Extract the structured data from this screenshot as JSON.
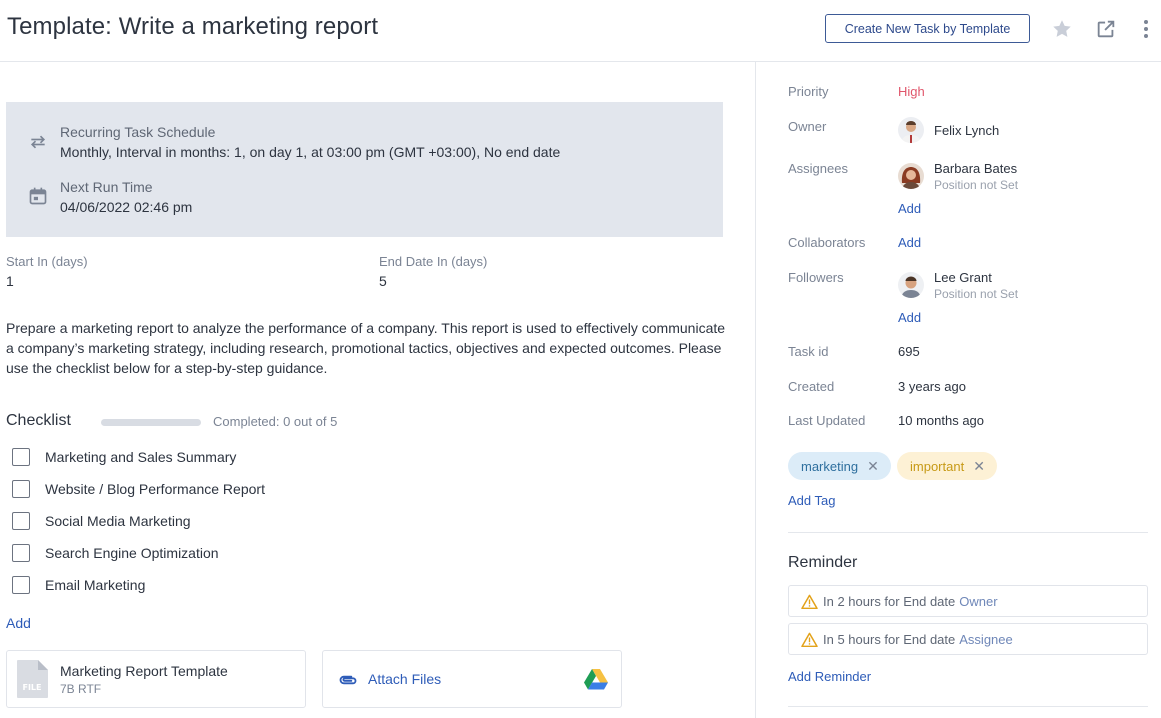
{
  "header": {
    "title": "Template: Write a marketing report",
    "create_button": "Create New Task by Template",
    "icons": [
      "star-icon",
      "external-link-icon",
      "more-vertical-icon"
    ]
  },
  "recurring": {
    "schedule_label": "Recurring Task Schedule",
    "schedule_value": "Monthly, Interval in months: 1, on day 1, at 03:00 pm (GMT +03:00), No end date",
    "next_run_label": "Next Run Time",
    "next_run_value": "04/06/2022 02:46 pm"
  },
  "fields": {
    "start_label": "Start In (days)",
    "start_value": "1",
    "end_label": "End Date In (days)",
    "end_value": "5"
  },
  "description": "Prepare a marketing report to analyze the performance of a company. This report is used to effectively communicate a company’s marketing strategy, including research, promotional tactics, objectives and expected outcomes. Please use the checklist below for a step-by-step guidance.",
  "checklist": {
    "title": "Checklist",
    "progress": 0,
    "progress_text": "Completed: 0 out of 5",
    "items": [
      {
        "label": "Marketing and Sales Summary",
        "checked": false
      },
      {
        "label": "Website / Blog Performance Report",
        "checked": false
      },
      {
        "label": "Social Media Marketing",
        "checked": false
      },
      {
        "label": "Search Engine Optimization",
        "checked": false
      },
      {
        "label": "Email Marketing",
        "checked": false
      }
    ],
    "add_label": "Add"
  },
  "files": {
    "file_name": "Marketing Report Template",
    "file_meta": "7B RTF",
    "file_icon_text": "FILE",
    "attach_label": "Attach Files"
  },
  "details": {
    "priority_label": "Priority",
    "priority_value": "High",
    "owner_label": "Owner",
    "owner_name": "Felix Lynch",
    "assignees_label": "Assignees",
    "assignee_name": "Barbara Bates",
    "assignee_position": "Position not Set",
    "assignees_add": "Add",
    "collaborators_label": "Collaborators",
    "collaborators_add": "Add",
    "followers_label": "Followers",
    "follower_name": "Lee Grant",
    "follower_position": "Position not Set",
    "followers_add": "Add",
    "task_id_label": "Task id",
    "task_id_value": "695",
    "created_label": "Created",
    "created_value": "3 years ago",
    "updated_label": "Last Updated",
    "updated_value": "10 months ago"
  },
  "tags": {
    "items": [
      "marketing",
      "important"
    ],
    "remove_symbol": "✕",
    "add_label": "Add Tag"
  },
  "reminder": {
    "title": "Reminder",
    "items": [
      {
        "text": "In 2 hours for End date",
        "role": "Owner"
      },
      {
        "text": "In 5 hours for End date",
        "role": "Assignee"
      }
    ],
    "add_label": "Add Reminder"
  },
  "colors": {
    "accent": "#2e5cb8",
    "priority_high": "#e0566b",
    "schedule_bg": "#e2e6ed",
    "warning": "#e3a21a"
  }
}
